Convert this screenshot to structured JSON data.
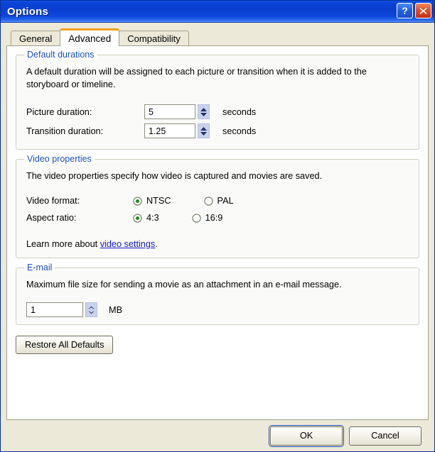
{
  "window": {
    "title": "Options",
    "controls": [
      {
        "name": "help-button",
        "icon": "question-mark-icon",
        "label": "?"
      },
      {
        "name": "close-button",
        "icon": "close-x-icon",
        "label": "X"
      }
    ]
  },
  "tabs": [
    {
      "label": "General",
      "active": false
    },
    {
      "label": "Advanced",
      "active": true
    },
    {
      "label": "Compatibility",
      "active": false
    }
  ],
  "groups": {
    "default_durations": {
      "legend": "Default durations",
      "description": "A default duration will be assigned to each picture or transition when it is added to the storyboard or timeline.",
      "picture": {
        "label": "Picture duration:",
        "value": "5",
        "unit": "seconds"
      },
      "transition": {
        "label": "Transition duration:",
        "value": "1.25",
        "unit": "seconds"
      }
    },
    "video_properties": {
      "legend": "Video properties",
      "description": "The video properties specify how video is captured and movies are saved.",
      "video_format": {
        "label": "Video format:",
        "options": [
          {
            "label": "NTSC",
            "selected": true
          },
          {
            "label": "PAL",
            "selected": false
          }
        ]
      },
      "aspect_ratio": {
        "label": "Aspect ratio:",
        "options": [
          {
            "label": "4:3",
            "selected": true
          },
          {
            "label": "16:9",
            "selected": false
          }
        ]
      },
      "learn_more_prefix": "Learn more about ",
      "learn_more_link": "video settings",
      "learn_more_suffix": "."
    },
    "email": {
      "legend": "E-mail",
      "description": "Maximum file size for sending a movie as an attachment in an e-mail message.",
      "max_size": {
        "value": "1",
        "unit": "MB"
      }
    }
  },
  "buttons": {
    "restore": "Restore All Defaults",
    "ok": "OK",
    "cancel": "Cancel"
  },
  "colors": {
    "titlebar_blue": "#0a3fd0",
    "dialog_beige": "#ece9d8",
    "group_legend_blue": "#1c4fc0",
    "active_tab_accent": "#f0a017",
    "link_blue": "#1818c8",
    "radio_selected_green": "#1f8a1f",
    "close_button_red": "#c62c10"
  }
}
